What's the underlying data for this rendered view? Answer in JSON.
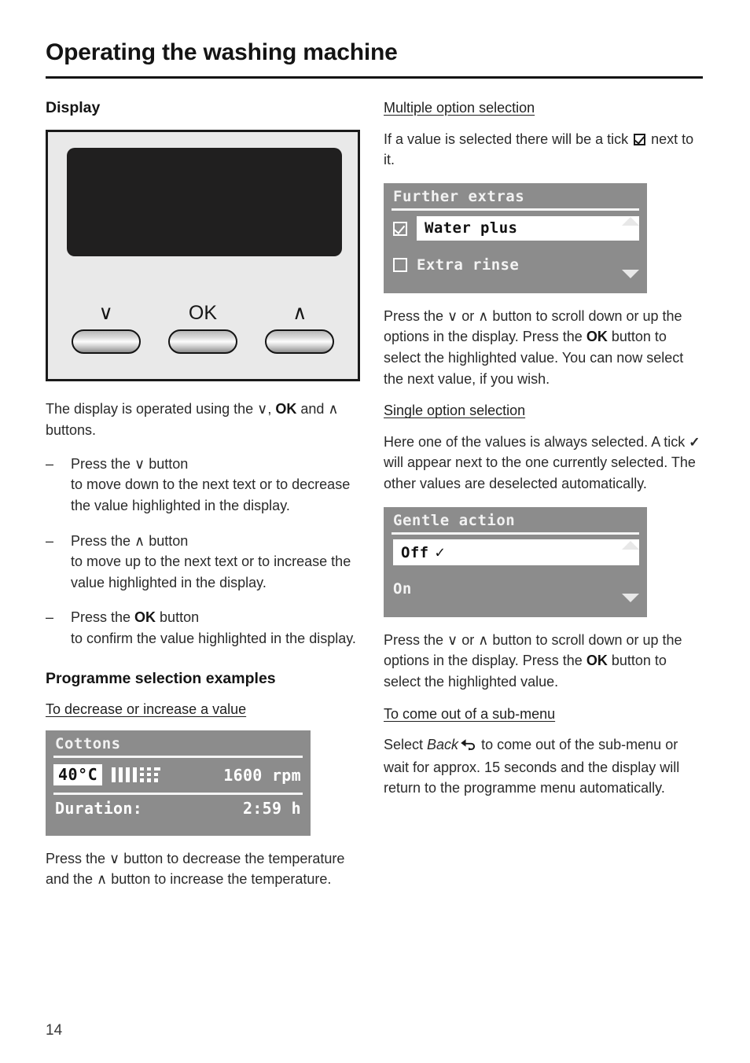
{
  "header": {
    "title": "Operating the washing machine"
  },
  "page_number": "14",
  "left_column": {
    "section_title": "Display",
    "panel_figure": {
      "buttons": [
        {
          "label": "∨",
          "name": "down"
        },
        {
          "label": "OK",
          "name": "ok"
        },
        {
          "label": "∧",
          "name": "up"
        }
      ]
    },
    "intro": {
      "part1": "The display is operated using the ∨, ",
      "bold_ok": "OK",
      "part2": " and ∧ buttons."
    },
    "bullets": [
      {
        "dash": "–",
        "line1_pre": "Press the ∨ button",
        "line1_bold": "",
        "line1_post": "",
        "rest": "to move down to the next text or to decrease the value highlighted in the display."
      },
      {
        "dash": "–",
        "line1_pre": "Press the ∧ button",
        "line1_bold": "",
        "line1_post": "",
        "rest": "to move up to the next text or to increase the value highlighted in the display."
      },
      {
        "dash": "–",
        "line1_pre": "Press the ",
        "line1_bold": "OK",
        "line1_post": " button",
        "rest": "to confirm the value highlighted in the display."
      }
    ],
    "examples_title": "Programme selection examples",
    "decrease_increase_title": "To decrease or increase a value",
    "cottons_lcd": {
      "title": "Cottons",
      "temperature": "40°C",
      "gauge_full_bars": 4,
      "gauge_dotted_bars": 3,
      "spin_speed": "1600 rpm",
      "duration_label": "Duration:",
      "duration_value": "2:59 h"
    },
    "decrease_increase_body_1": "Press the ∨ button to decrease the temperature and the ∧ button to increase the temperature."
  },
  "right_column": {
    "multiple_title": "Multiple option selection",
    "multiple_intro_pre": "If a value is selected there will be a tick ",
    "multiple_intro_post": " next to it.",
    "further_extras_lcd": {
      "title": "Further extras",
      "options": [
        {
          "label": "Water plus",
          "checked": true,
          "highlighted": true
        },
        {
          "label": "Extra rinse",
          "checked": false,
          "highlighted": false
        }
      ],
      "scroll_up_icon": "triangle-up",
      "scroll_down_icon": "triangle-down"
    },
    "multiple_body_pre": "Press the ∨ or ∧ button to scroll down or up the options in the display. Press the ",
    "multiple_body_bold": "OK",
    "multiple_body_post": " button to select the highlighted value. You can now select the next value, if you wish.",
    "single_title": "Single option selection",
    "single_intro_pre": "Here one of the values is always selected. A tick ",
    "single_intro_tick": "✓",
    "single_intro_post": " will appear next to the one currently selected. The other values are deselected automatically.",
    "gentle_action_lcd": {
      "title": "Gentle action",
      "options": [
        {
          "label": "Off",
          "tick": "✓",
          "highlighted": true
        },
        {
          "label": "On",
          "tick": "",
          "highlighted": false
        }
      ],
      "scroll_up_icon": "triangle-up",
      "scroll_down_icon": "triangle-down"
    },
    "single_body_pre": "Press the ∨ or ∧ button to scroll down or up the options in the display. Press the ",
    "single_body_bold": "OK",
    "single_body_post": " button to select the highlighted value.",
    "submenu_title": "To come out of a sub-menu",
    "submenu_body_pre": "Select ",
    "submenu_body_italic": "Back",
    "submenu_body_post": " to come out of the sub-menu or wait for approx. 15 seconds and the display will return to the programme menu automatically."
  },
  "colors": {
    "lcd_background": "#8c8c8c",
    "lcd_text": "#ffffff",
    "panel_background": "#e9e9e9",
    "screen_dark": "#201f1f",
    "ink": "#1a1a1a"
  }
}
